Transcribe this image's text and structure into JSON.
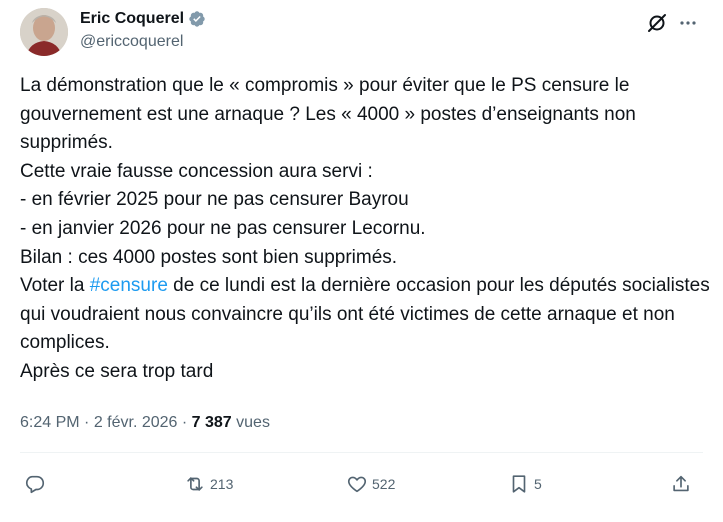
{
  "author": {
    "display_name": "Eric Coquerel",
    "handle": "@ericcoquerel",
    "verified": true
  },
  "tweet": {
    "text_before_hashtag": "La démonstration que le « compromis » pour éviter que le PS censure le gouvernement est une arnaque ? Les « 4000 » postes d’enseignants non supprimés.\nCette vraie fausse concession aura servi :\n- en février 2025 pour ne pas censurer Bayrou\n- en janvier 2026 pour ne pas censurer Lecornu.\nBilan : ces 4000 postes sont bien supprimés.\nVoter la ",
    "hashtag": "#censure",
    "text_after_hashtag": " de ce lundi est la dernière occasion pour les députés socialistes qui voudraient nous convaincre qu’ils ont été victimes de cette arnaque et non complices.\nAprès ce sera trop tard",
    "time": "6:24 PM",
    "separator": " · ",
    "date": "2 févr. 2026",
    "views_count": "7 387",
    "views_label": " vues"
  },
  "actions": {
    "reply_count": "",
    "retweet_count": "213",
    "like_count": "522",
    "bookmark_count": "5"
  },
  "colors": {
    "accent": "#1d9bf0",
    "muted": "#536471",
    "text": "#0f1419"
  },
  "icons": [
    "verified-badge-icon",
    "grok-icon",
    "more-icon",
    "reply-icon",
    "retweet-icon",
    "like-icon",
    "bookmark-icon",
    "share-icon"
  ]
}
